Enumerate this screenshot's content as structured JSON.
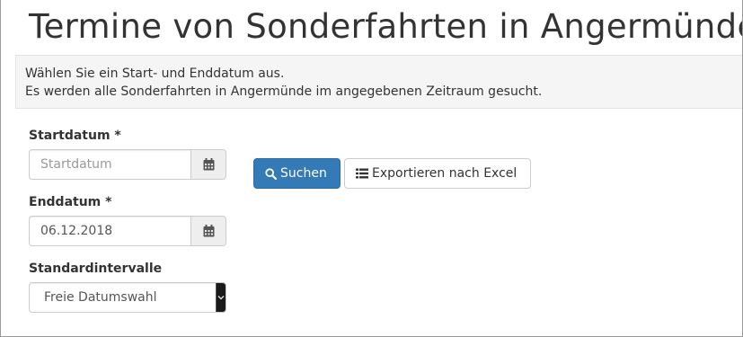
{
  "page": {
    "title": "Termine von Sonderfahrten in Angermünde"
  },
  "info": {
    "line1": "Wählen Sie ein Start- und Enddatum aus.",
    "line2": "Es werden alle Sonderfahrten in Angermünde im angegebenen Zeitraum gesucht."
  },
  "form": {
    "start": {
      "label": "Startdatum *",
      "value": "",
      "placeholder": "Startdatum",
      "icon": "calendar-icon"
    },
    "end": {
      "label": "Enddatum *",
      "value": "06.12.2018",
      "placeholder": "",
      "icon": "calendar-icon"
    },
    "interval": {
      "label": "Standardintervalle",
      "selected": "Freie Datumswahl"
    }
  },
  "actions": {
    "search_label": "Suchen",
    "search_icon": "search-icon",
    "export_label": "Exportieren nach Excel",
    "export_icon": "list-icon"
  },
  "colors": {
    "primary": "#337ab7",
    "info_bg": "#f5f5f5",
    "addon_bg": "#eeeeee"
  }
}
